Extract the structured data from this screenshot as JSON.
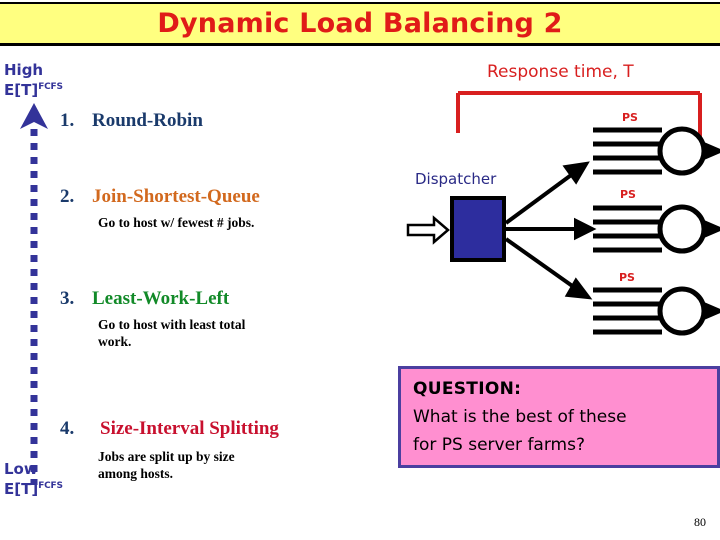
{
  "slide": {
    "title": "Dynamic Load Balancing 2",
    "page_number": "80",
    "title_bg_color": "#ffff80",
    "title_text_color": "#e01b18"
  },
  "axis": {
    "high_label": "High",
    "high_metric": "E[T]",
    "high_superscript": "FCFS",
    "low_label": "Low",
    "low_metric": "E[T]",
    "low_superscript": "FCFS",
    "arrow_color": "#333399",
    "arrow_direction": "up"
  },
  "policies": [
    {
      "number": "1.",
      "title": "Round-Robin",
      "color": "#1a3a6b",
      "subtitle": ""
    },
    {
      "number": "2.",
      "title": "Join-Shortest-Queue",
      "color": "#d2691e",
      "subtitle": "Go to host w/ fewest # jobs."
    },
    {
      "number": "3.",
      "title": "Least-Work-Left",
      "color": "#128a28",
      "subtitle_line1": "Go to host with least total",
      "subtitle_line2": "work."
    },
    {
      "number": "4.",
      "title": "Size-Interval Splitting",
      "color": "#c8102e",
      "subtitle_line1": "Jobs are split up by size",
      "subtitle_line2": "among hosts."
    }
  ],
  "diagram": {
    "response_time_label": "Response time, T",
    "bracket_color": "#d81f1f",
    "dispatcher_label": "Dispatcher",
    "dispatcher_color": "#2a2a86",
    "server_label": "PS",
    "server_label_color": "#d81f1f",
    "server_count": 3
  },
  "question": {
    "heading": "QUESTION:",
    "line1": "What is the best of these",
    "line2": "for PS server farms?",
    "bg_color": "#ff8fd0",
    "border_color": "#4b3fa0"
  }
}
